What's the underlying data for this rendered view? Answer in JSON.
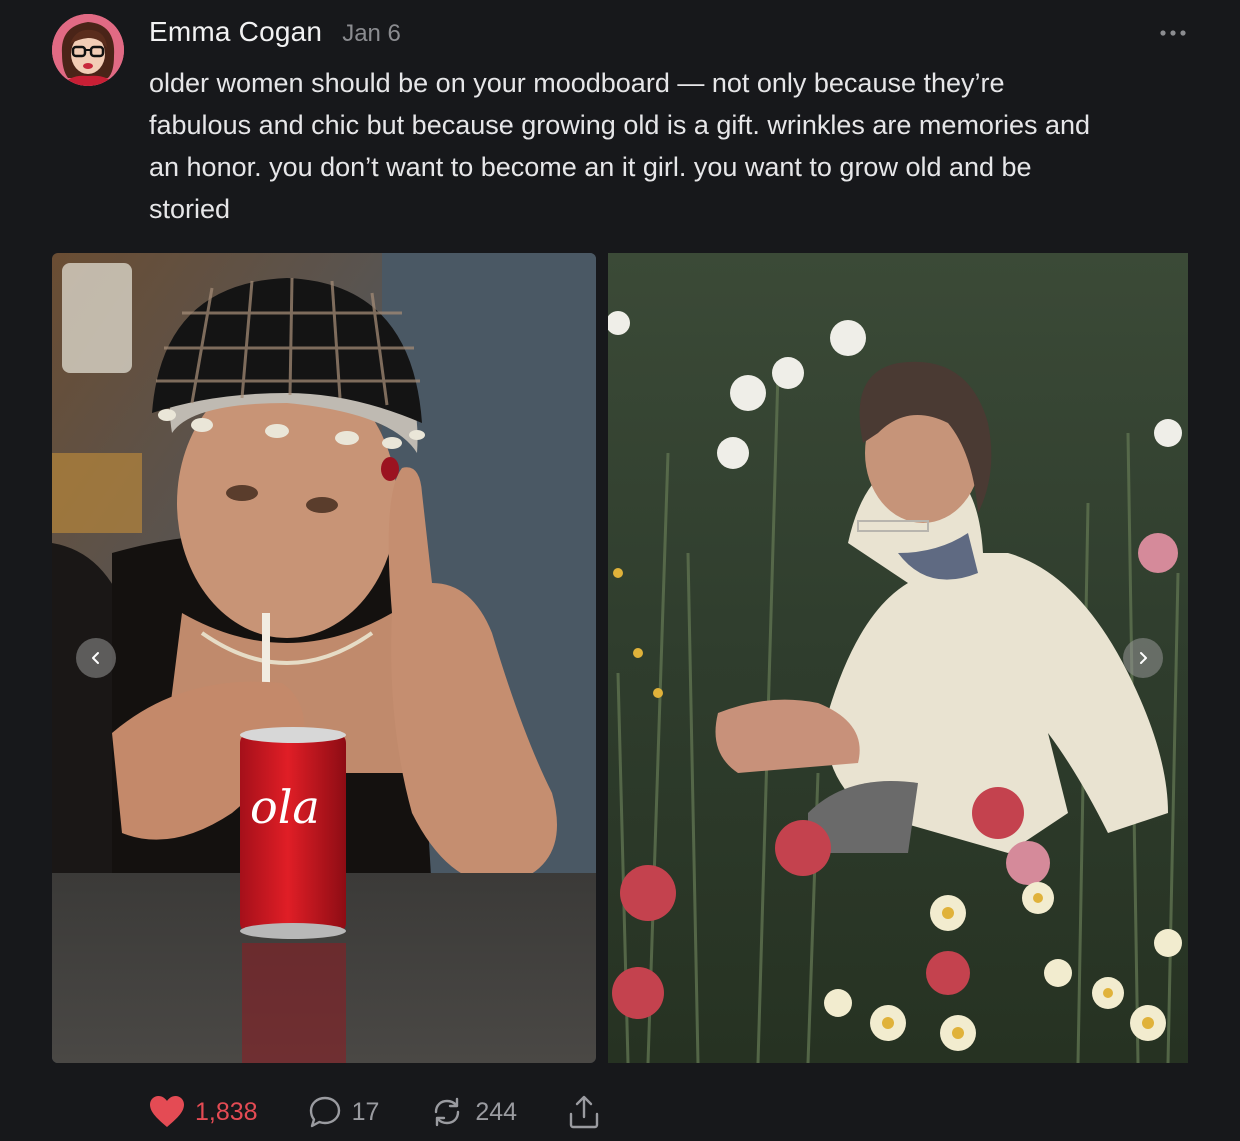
{
  "post": {
    "author": "Emma Cogan",
    "date": "Jan 6",
    "text": "older women should be on your moodboard — not only because they’re\nfabulous and chic but because growing old is a gift. wrinkles are memories and\nan honor. you don’t want to become an it girl. you want to grow old and be\nstoried"
  },
  "icons": {
    "more": "more-dots-icon",
    "prev": "chevron-left-icon",
    "next": "chevron-right-icon",
    "like": "heart-icon",
    "comment": "comment-bubble-icon",
    "repost": "repost-arrows-icon",
    "share": "share-upload-icon"
  },
  "actions": {
    "likes": "1,838",
    "comments": "17",
    "reposts": "244"
  },
  "colors": {
    "background": "#17181b",
    "like_accent": "#e44b54",
    "muted": "#9a9ba0"
  }
}
